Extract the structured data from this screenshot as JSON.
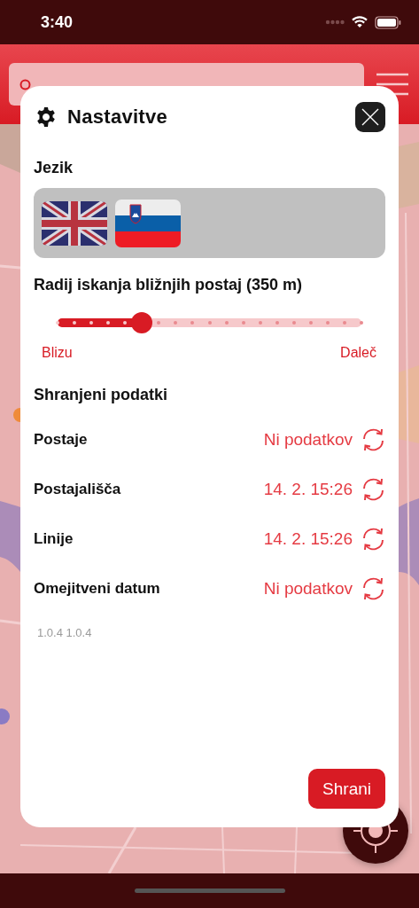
{
  "status_bar": {
    "time": "3:40"
  },
  "settings": {
    "title": "Nastavitve",
    "language": {
      "label": "Jezik",
      "options": [
        {
          "kind": "english"
        },
        {
          "kind": "slovenian"
        }
      ]
    },
    "radius": {
      "label": "Radij iskanja bližnjih postaj (350 m)",
      "level": 0.278,
      "min_label": "Blizu",
      "max_label": "Daleč"
    },
    "saved_data": {
      "label": "Shranjeni podatki",
      "rows": [
        {
          "name": "Postaje",
          "value": "Ni podatkov"
        },
        {
          "name": "Postajališča",
          "value": "14. 2. 15:26"
        },
        {
          "name": "Linije",
          "value": "14. 2. 15:26"
        },
        {
          "name": "Omejitveni datum",
          "value": "Ni podatkov"
        }
      ]
    },
    "version": "1.0.4 1.0.4",
    "save_button": "Shrani"
  }
}
